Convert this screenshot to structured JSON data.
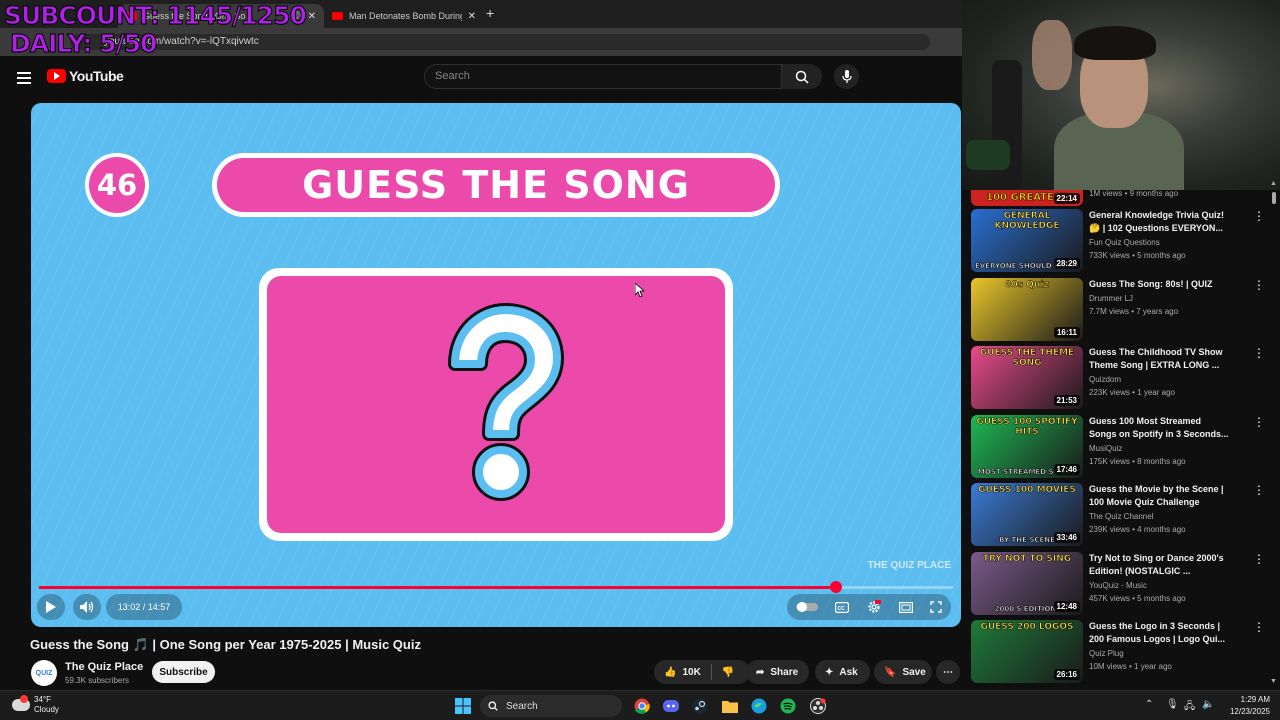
{
  "overlay": {
    "line1": "SUBCOUNT: 1145/1250",
    "line2": "DAILY: 5/50"
  },
  "browser": {
    "active_tab_title": "Guess the Song | One So",
    "other_tab_title": "Man Detonates Bomb During H",
    "new_tab": "+",
    "close": "✕",
    "url": "youtube.com/watch?v=-lQTxqivwtc"
  },
  "youtube": {
    "logo_text": "YouTube",
    "search_placeholder": "Search"
  },
  "video": {
    "question_number": "46",
    "banner_text": "GUESS THE SONG",
    "watermark": "THE QUIZ PLACE",
    "time_display": "13:02 / 14:57",
    "progress": 0.872,
    "title": "Guess the Song 🎵 | One Song per Year 1975-2025 | Music Quiz",
    "channel_name": "The Quiz Place",
    "channel_subs": "59.3K subscribers",
    "avatar_text": "QUIZ",
    "subscribe_label": "Subscribe",
    "like_count": "10K",
    "share_label": "Share",
    "ask_label": "Ask",
    "save_label": "Save"
  },
  "sidebar": {
    "partial": {
      "meta": "1M views • 9 months ago",
      "thumb_caption": "100 GREATEST",
      "duration": "22:14"
    },
    "recommendations": [
      {
        "title": "General Knowledge Trivia Quiz! 🤔 | 102 Questions EVERYON...",
        "channel": "Fun Quiz Questions",
        "meta": "733K views • 5 months ago",
        "duration": "28:29",
        "thumb_caption": "GENERAL KNOWLEDGE",
        "thumb_bottom": "EVERYONE SHOULD KNOW",
        "thumb_color": "#2a6fd1"
      },
      {
        "title": "Guess The Song: 80s! | QUIZ",
        "channel": "Drummer LJ",
        "meta": "7.7M views • 7 years ago",
        "duration": "16:11",
        "thumb_caption": "80s Quiz",
        "thumb_bottom": "",
        "thumb_color": "#e9c62a"
      },
      {
        "title": "Guess The Childhood TV Show Theme Song | EXTRA LONG ...",
        "channel": "Quizdom",
        "meta": "223K views • 1 year ago",
        "duration": "21:53",
        "thumb_caption": "GUESS THE THEME SONG",
        "thumb_bottom": "",
        "thumb_color": "#e84a8a"
      },
      {
        "title": "Guess 100 Most Streamed Songs on Spotify in 3 Seconds...",
        "channel": "MusiQuiz",
        "meta": "175K views • 8 months ago",
        "duration": "17:46",
        "thumb_caption": "GUESS 100 SPOTIFY HITS",
        "thumb_bottom": "MOST STREAMED SONGS",
        "thumb_color": "#1db954"
      },
      {
        "title": "Guess the Movie by the Scene | 100 Movie Quiz Challenge",
        "channel": "The Quiz Channel",
        "meta": "239K views • 4 months ago",
        "duration": "33:46",
        "thumb_caption": "GUESS 100 MOVIES",
        "thumb_bottom": "BY THE SCENE",
        "thumb_color": "#3a7bd5"
      },
      {
        "title": "Try Not to Sing or Dance 2000's Edition! (NOSTALGIC ...",
        "channel": "YouQuiz - Music",
        "meta": "457K views • 5 months ago",
        "duration": "12:48",
        "thumb_caption": "TRY NOT TO SING",
        "thumb_bottom": "2000'S EDITION!",
        "thumb_color": "#7a5a8a"
      },
      {
        "title": "Guess the Logo in 3 Seconds | 200 Famous Logos | Logo Qui...",
        "channel": "Quiz Plug",
        "meta": "10M views • 1 year ago",
        "duration": "26:16",
        "thumb_caption": "GUESS 200 LOGOS",
        "thumb_bottom": "",
        "thumb_color": "#1d7a3a"
      }
    ]
  },
  "taskbar": {
    "temp": "34°F",
    "condition": "Cloudy",
    "search_label": "Search",
    "time": "1:29 AM",
    "date": "12/23/2025"
  },
  "colors": {
    "accent": "#ff0033",
    "pink": "#ec4aaa",
    "video_bg": "#5bbdf0",
    "overlay": "#b020e8"
  }
}
